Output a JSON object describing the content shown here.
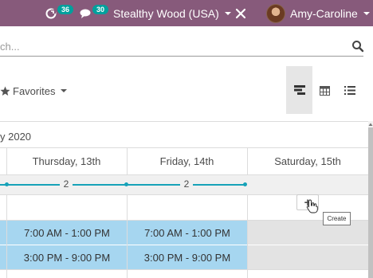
{
  "topbar": {
    "activity": {
      "icon": "activity-icon",
      "count": "36"
    },
    "messages": {
      "icon": "chat-icon",
      "count": "30"
    },
    "company": "Stealthy Wood (USA)",
    "debug_icon": "wrench-icon",
    "user": "Amy-Caroline",
    "bg_color": "#875a7b",
    "badge_color": "#00a09d"
  },
  "search": {
    "placeholder": "ch..."
  },
  "filters": {
    "favorites_label": "Favorites"
  },
  "views": [
    "gantt-view-icon",
    "calendar-view-icon",
    "list-view-icon"
  ],
  "calendar": {
    "month_label": "y 2020",
    "columns": [
      {
        "label": "Thursday, 13th",
        "count": "2",
        "shifts": [
          "7:00 AM - 1:00 PM",
          "3:00 PM - 9:00 PM"
        ]
      },
      {
        "label": "Friday, 14th",
        "count": "2",
        "shifts": [
          "7:00 AM - 1:00 PM",
          "3:00 PM - 9:00 PM"
        ]
      },
      {
        "label": "Saturday, 15th",
        "count": "",
        "shifts": []
      }
    ],
    "create_button": "+",
    "create_tooltip": "Create",
    "shift_color": "#a6d6f0",
    "line_color": "#17a2b8"
  }
}
